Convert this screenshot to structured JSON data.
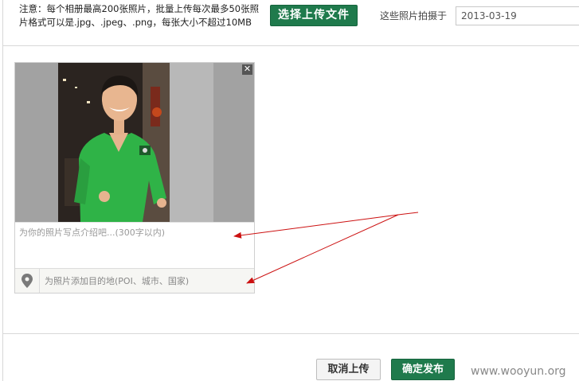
{
  "header": {
    "notice_line1": "注意：每个相册最高200张照片，批量上传每次最多50张照",
    "notice_line2": "片格式可以是.jpg、.jpeg、.png，每张大小不超过10MB",
    "upload_button": "选择上传文件",
    "date_label": "这些照片拍摄于",
    "date_value": "2013-03-19"
  },
  "photo_card": {
    "close_symbol": "✕",
    "description_placeholder": "为你的照片写点介绍吧...(300字以内)",
    "location_placeholder": "为照片添加目的地(POI、城市、国家)"
  },
  "footer": {
    "cancel_button": "取消上传",
    "publish_button": "确定发布"
  },
  "watermark": "www.wooyun.org",
  "colors": {
    "accent_green": "#1f7a4c",
    "annotation_red": "#cc1111"
  },
  "icons": {
    "close": "close-icon",
    "location": "map-pin-icon"
  }
}
